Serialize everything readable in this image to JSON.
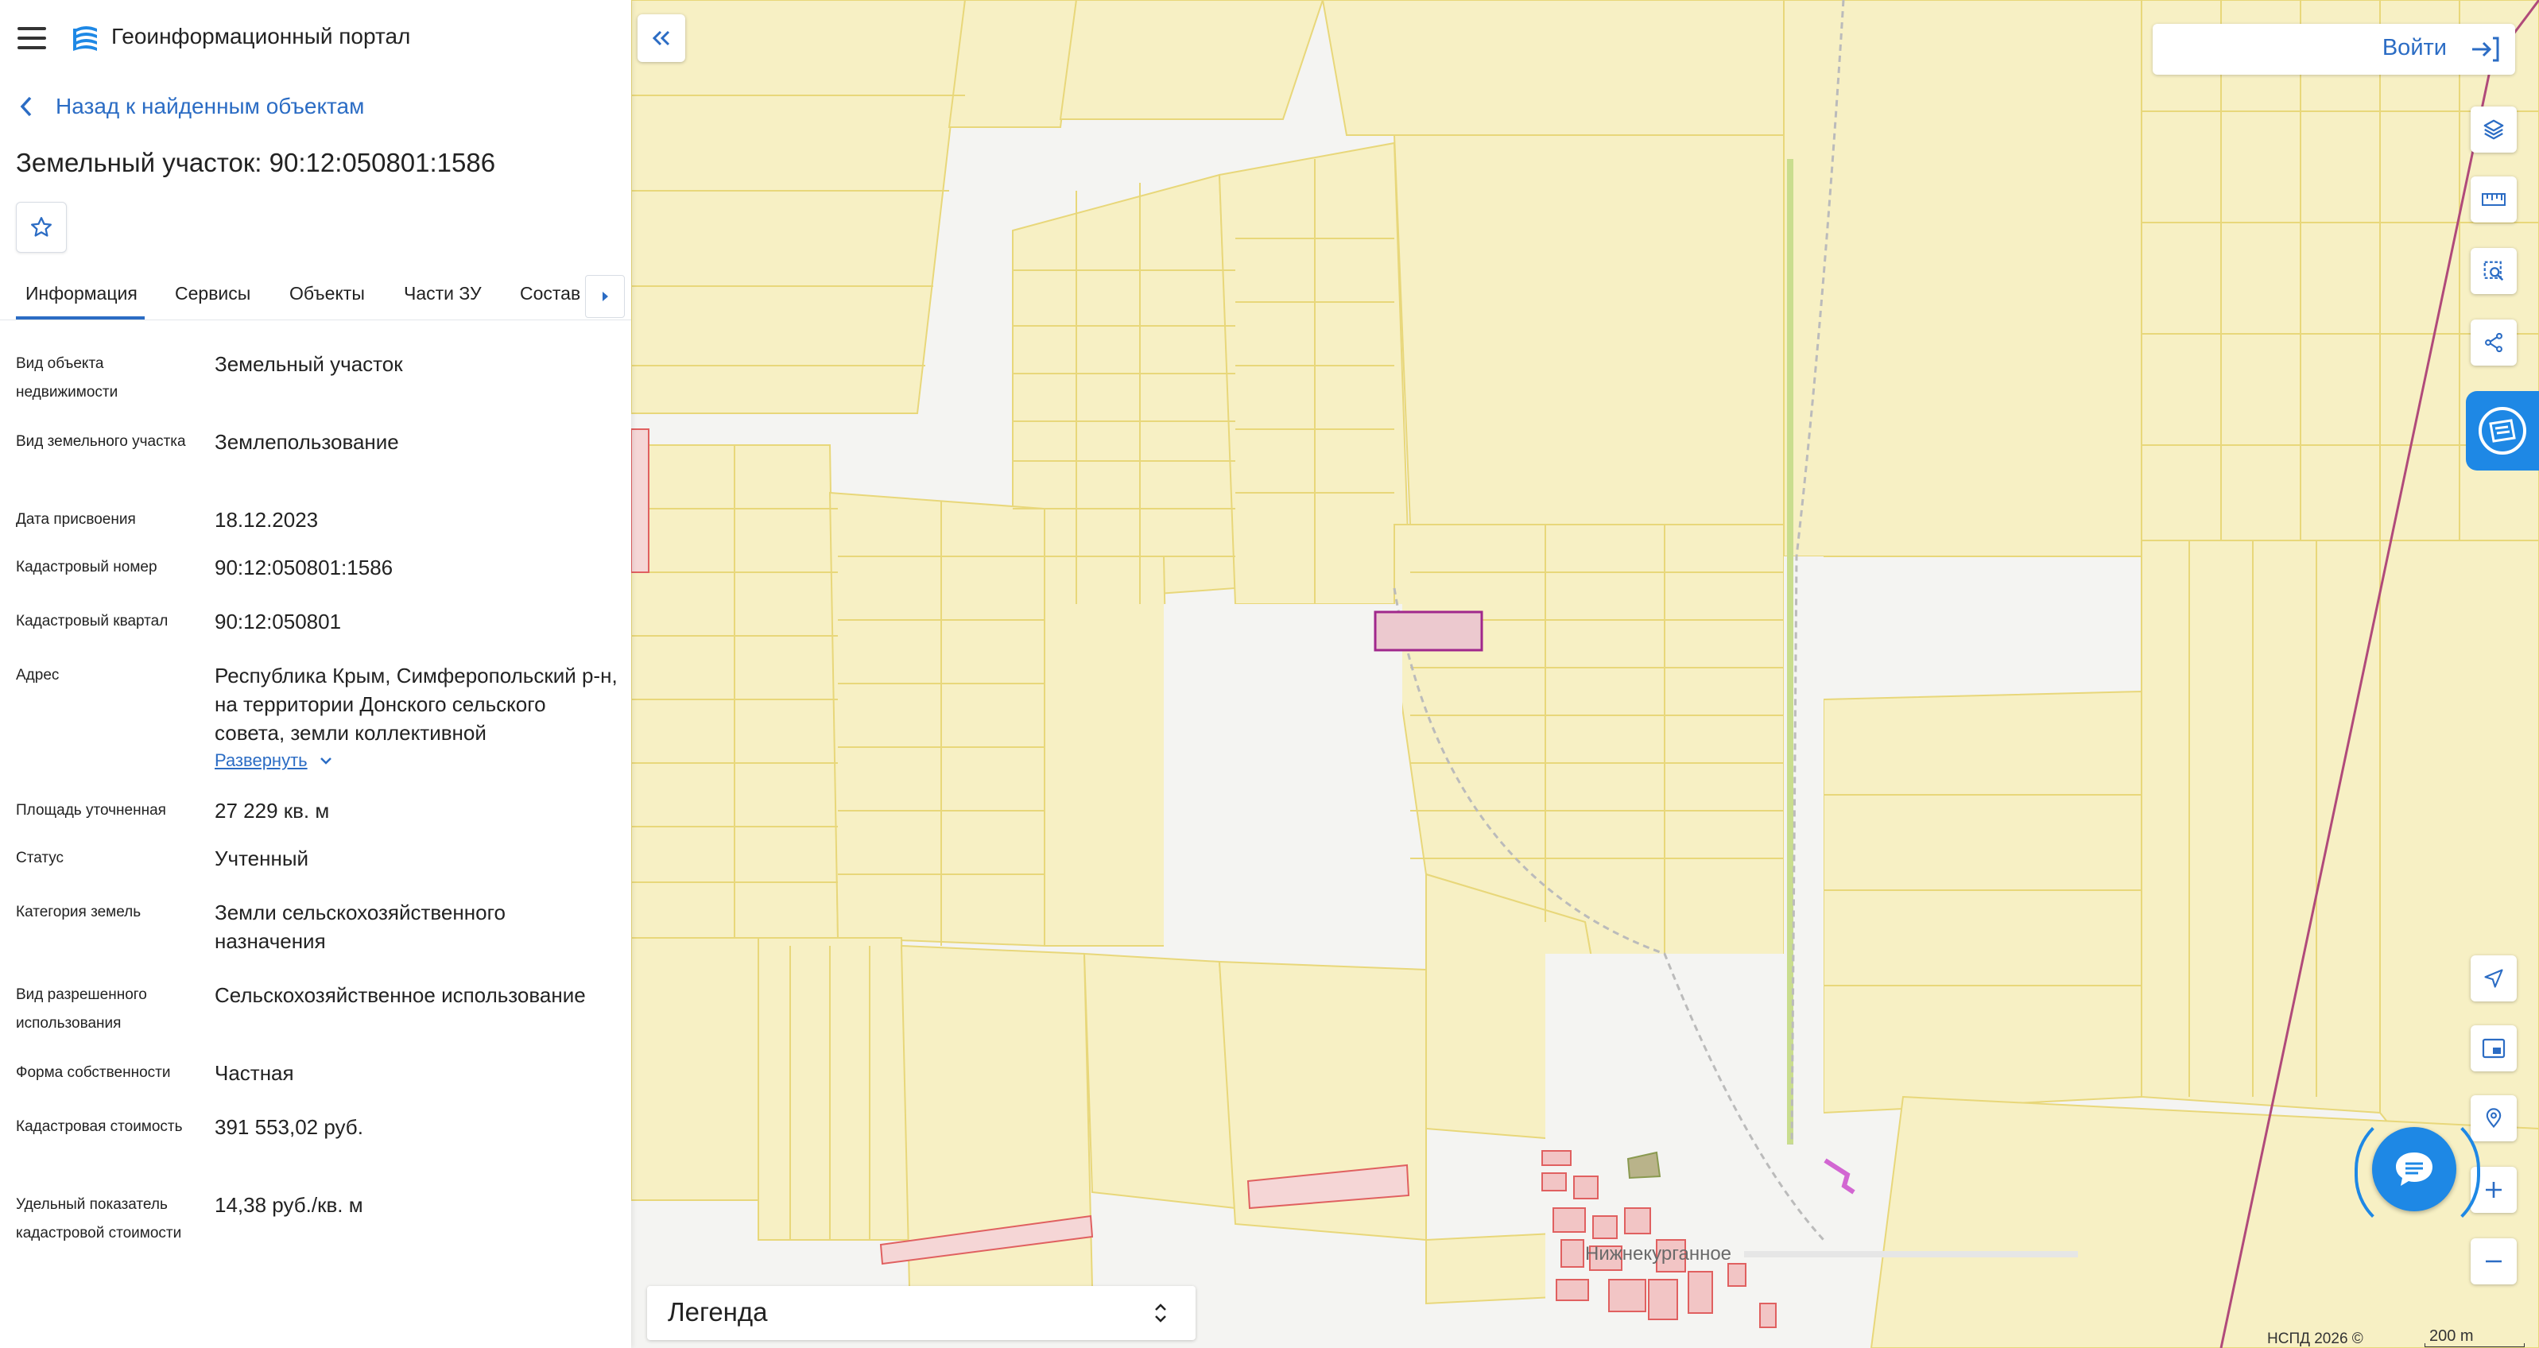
{
  "header": {
    "title": "Геоинформационный портал"
  },
  "back_link": "Назад к найденным объектам",
  "object_title": "Земельный участок: 90:12:050801:1586",
  "tabs": [
    {
      "label": "Информация"
    },
    {
      "label": "Сервисы"
    },
    {
      "label": "Объекты"
    },
    {
      "label": "Части ЗУ"
    },
    {
      "label": "Состав"
    }
  ],
  "properties": [
    {
      "label": "Вид объекта недвижимости",
      "value": "Земельный участок"
    },
    {
      "label": "Вид земельного участка",
      "value": "Землепользование"
    },
    {
      "label": "Дата присвоения",
      "value": "18.12.2023"
    },
    {
      "label": "Кадастровый номер",
      "value": "90:12:050801:1586"
    },
    {
      "label": "Кадастровый квартал",
      "value": "90:12:050801"
    },
    {
      "label": "Адрес",
      "value": "Республика Крым, Симферопольский р-н, на территории Донского сельского совета, земли коллективной"
    },
    {
      "label": "Площадь уточненная",
      "value": "27 229 кв. м"
    },
    {
      "label": "Статус",
      "value": "Учтенный"
    },
    {
      "label": "Категория земель",
      "value": "Земли сельскохозяйственного назначения"
    },
    {
      "label": "Вид разрешенного использования",
      "value": "Сельскохозяйственное использование"
    },
    {
      "label": "Форма собственности",
      "value": "Частная"
    },
    {
      "label": "Кадастровая стоимость",
      "value": "391 553,02 руб."
    },
    {
      "label": "Удельный показатель кадастровой стоимости",
      "value": "14,38 руб./кв. м"
    }
  ],
  "expand_label": "Развернуть",
  "login_label": "Войти",
  "legend_label": "Легенда",
  "map": {
    "village_label": "Нижнекурганное",
    "copyright": "НСПД 2026 ©",
    "scale_label": "200 m"
  },
  "colors": {
    "accent": "#2b6cc4",
    "parcel_fill": "#f7f0c4",
    "parcel_stroke": "#e8d77a",
    "selected_stroke": "#a0288c",
    "red_parcel": "#e06060",
    "railway": "#b04a7a"
  }
}
